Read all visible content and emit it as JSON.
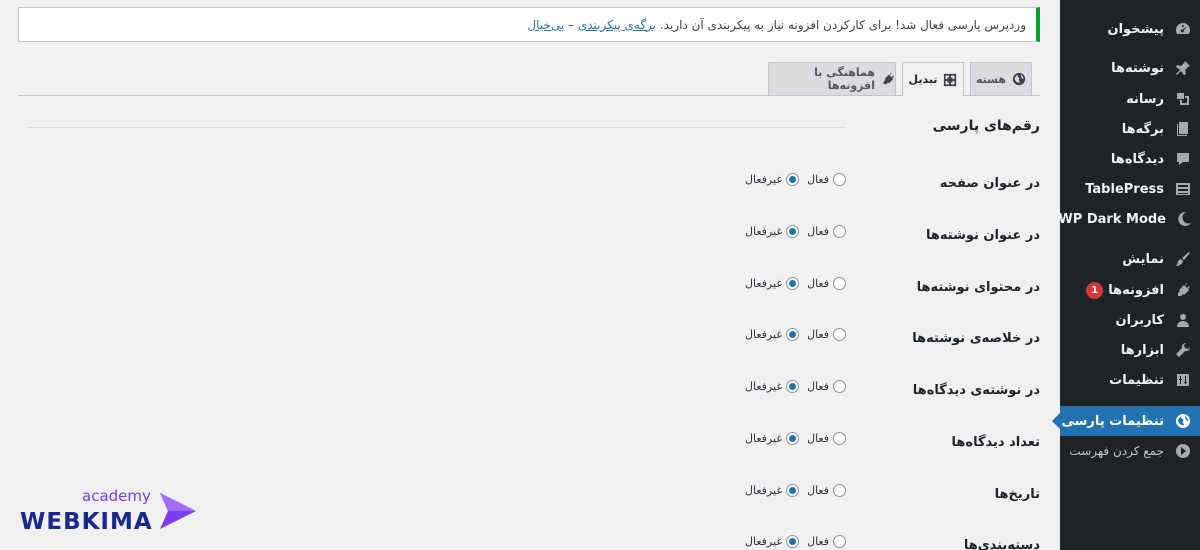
{
  "sidebar": {
    "items": [
      {
        "label": "پیشخوان",
        "icon": "dashboard-icon",
        "active": false
      },
      {
        "label": "نوشته‌ها",
        "icon": "pin-icon",
        "active": false
      },
      {
        "label": "رسانه",
        "icon": "media-icon",
        "active": false
      },
      {
        "label": "برگه‌ها",
        "icon": "pages-icon",
        "active": false
      },
      {
        "label": "دیدگاه‌ها",
        "icon": "comments-icon",
        "active": false
      },
      {
        "label": "TablePress",
        "icon": "table-icon",
        "active": false
      },
      {
        "label": "WP Dark Mode",
        "icon": "moon-icon",
        "active": false
      },
      {
        "label": "نمایش",
        "icon": "appearance-icon",
        "active": false
      },
      {
        "label": "افزونه‌ها",
        "icon": "plugins-icon",
        "active": false,
        "badge": "1"
      },
      {
        "label": "کاربران",
        "icon": "users-icon",
        "active": false
      },
      {
        "label": "ابزارها",
        "icon": "tools-icon",
        "active": false
      },
      {
        "label": "تنظیمات",
        "icon": "settings-icon",
        "active": false
      },
      {
        "label": "تنظیمات پارسی",
        "icon": "globe-icon",
        "active": true
      },
      {
        "label": "جمع کردن فهرست",
        "icon": "collapse-icon",
        "active": false
      }
    ]
  },
  "notice": {
    "text": "وردپرس پارسی فعال شد! برای کارکردن افزونه نیاز به پیکربندی آن دارید.",
    "link_configure": "برگه‌ی پیکربندی",
    "separator": "–",
    "link_dismiss": "بی‌خیال"
  },
  "tabs": [
    {
      "label": "هسته",
      "icon": "globe-icon",
      "active": false
    },
    {
      "label": "تبدیل",
      "icon": "convert-icon",
      "active": true
    },
    {
      "label": "هماهنگی با افزونه‌ها",
      "icon": "plugin-icon",
      "active": false
    }
  ],
  "section": {
    "title": "رقم‌های پارسی"
  },
  "options": {
    "on_label": "فعال",
    "off_label": "غیرفعال"
  },
  "rows": [
    {
      "label": "در عنوان صفحه",
      "value": "off"
    },
    {
      "label": "در عنوان نوشته‌ها",
      "value": "off"
    },
    {
      "label": "در محتوای نوشته‌ها",
      "value": "off"
    },
    {
      "label": "در خلاصه‌ی نوشته‌ها",
      "value": "off"
    },
    {
      "label": "در نوشته‌ی دیدگاه‌ها",
      "value": "off"
    },
    {
      "label": "تعداد دیدگاه‌ها",
      "value": "off"
    },
    {
      "label": "تاریخ‌ها",
      "value": "off"
    },
    {
      "label": "دسته‌بندی‌ها",
      "value": "off"
    }
  ],
  "logo": {
    "academy": "academy",
    "brand": "WEBKIMA"
  },
  "colors": {
    "sidebar_bg": "#1d2327",
    "accent": "#2271b1",
    "notice_border": "#00a32a",
    "badge": "#d63638"
  }
}
